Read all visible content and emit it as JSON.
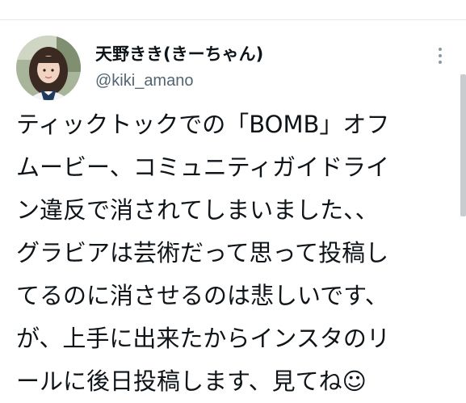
{
  "tweet": {
    "author": {
      "display_name": "天野きき(きーちゃん)",
      "handle": "@kiki_amano"
    },
    "more_icon": "more-horizontal-icon",
    "text_lines": [
      "ティックトックでの「BOMB」オフ",
      "ムービー、コミュニティガイドライ",
      "ン違反で消されてしまいました、、",
      "グラビアは芸術だって思って投稿し",
      "てるのに消させるのは悲しいです、",
      "が、上手に出来たからインスタのリ",
      "ールに後日投稿します、見てね☺"
    ]
  },
  "colors": {
    "text": "#0f1419",
    "handle": "#536471",
    "divider": "#e6e9ec"
  }
}
